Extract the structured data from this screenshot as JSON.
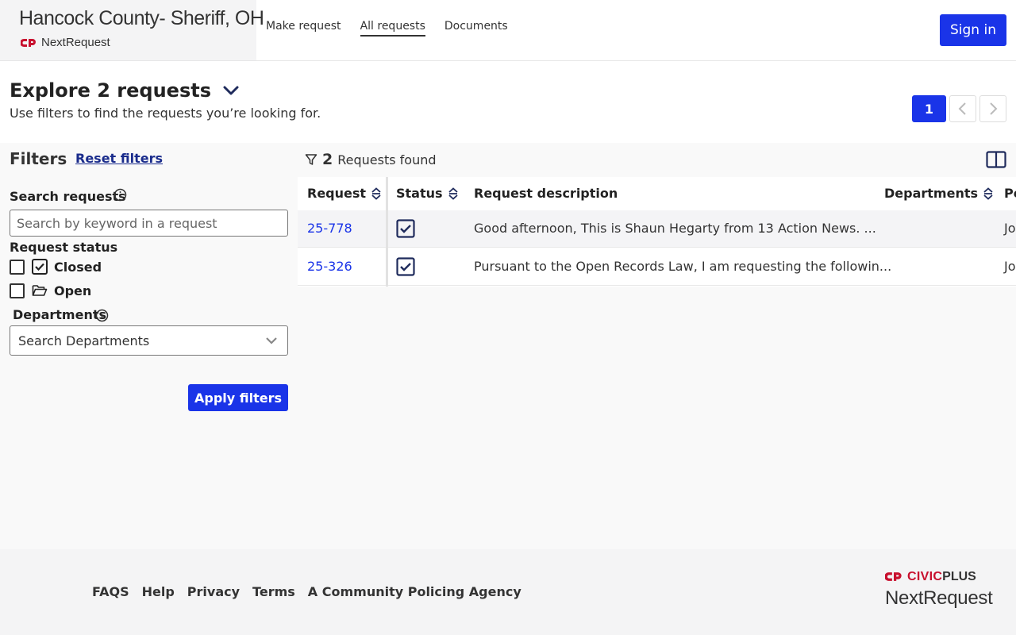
{
  "header": {
    "agency_name": "Hancock County- Sheriff, OH",
    "logo_text": "NextRequest",
    "nav": [
      "Make request",
      "All requests",
      "Documents"
    ],
    "active_nav": "All requests",
    "sign_in_label": "Sign in"
  },
  "explore": {
    "title": "Explore 2 requests",
    "subtitle": "Use filters to find the requests you’re looking for.",
    "current_page": "1"
  },
  "filters": {
    "title": "Filters",
    "reset_label": "Reset filters",
    "search_label": "Search requests",
    "search_placeholder": "Search by keyword in a request",
    "status_label": "Request status",
    "status_options": [
      {
        "label": "Closed",
        "checked": false
      },
      {
        "label": "Open",
        "checked": false
      }
    ],
    "departments_label": "Departments",
    "departments_placeholder": "Search Departments",
    "apply_label": "Apply filters"
  },
  "results": {
    "count": "2",
    "found_text": "Requests found",
    "columns": [
      "Request",
      "Status",
      "Request description",
      "Departments",
      "Po"
    ],
    "rows": [
      {
        "id": "25-778",
        "status": "Closed",
        "description": "Good afternoon, This is Shaun Hegarty from 13 Action News. ...",
        "departments": "",
        "poc": "Jo"
      },
      {
        "id": "25-326",
        "status": "Closed",
        "description": "Pursuant to the Open Records Law, I am requesting the followin...",
        "departments": "",
        "poc": "Jo"
      }
    ]
  },
  "footer": {
    "links": [
      "FAQS",
      "Help",
      "Privacy",
      "Terms",
      "A Community Policing Agency"
    ],
    "brand_civic": "CIVIC",
    "brand_plus": "PLUS",
    "brand_product": "NextRequest"
  },
  "colors": {
    "primary": "#1a34e8",
    "brand_red": "#c8102e"
  }
}
